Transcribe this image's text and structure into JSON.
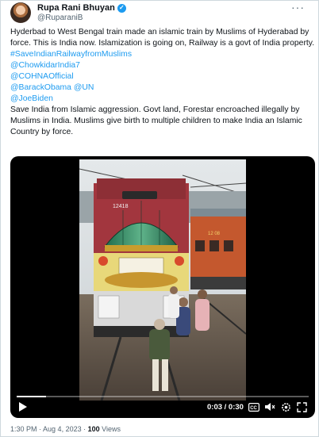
{
  "author": {
    "display_name": "Rupa Rani Bhuyan",
    "handle": "@RuparaniB",
    "verified_icon": "verified-badge-icon",
    "more_icon": "more-options-icon"
  },
  "tweet": {
    "line_main": "Hyderbad to West Bengal train made an islamic train by Muslims of Hyderabad by force. This is India now. Islamization is going on, Railway is a govt of India property.",
    "links": [
      "#SaveIndianRailwayfromMuslims",
      "@ChowkidarIndia7",
      "@COHNAOfficial",
      "@BarackObama @UN",
      "@JoeBiden"
    ],
    "line_end": "Save India from Islamic aggression. Govt land, Forestar encroached illegally by Muslims in India. Muslims give birth to multiple children to make India an Islamic Country by force."
  },
  "video": {
    "time_display": "0:03 / 0:30",
    "progress": 0.1,
    "controls": [
      "play-icon",
      "closed-captions-icon",
      "volume-icon",
      "settings-icon",
      "fullscreen-icon"
    ],
    "locomotive_number": "12418"
  },
  "meta": {
    "time": "1:30 PM",
    "separator": " · ",
    "date": "Aug 4, 2023",
    "views_count": "100",
    "views_label": " Views"
  },
  "colors": {
    "link": "#1d9bf0",
    "secondary_text": "#536471",
    "primary_text": "#0f1419",
    "border": "#cfd9de"
  }
}
